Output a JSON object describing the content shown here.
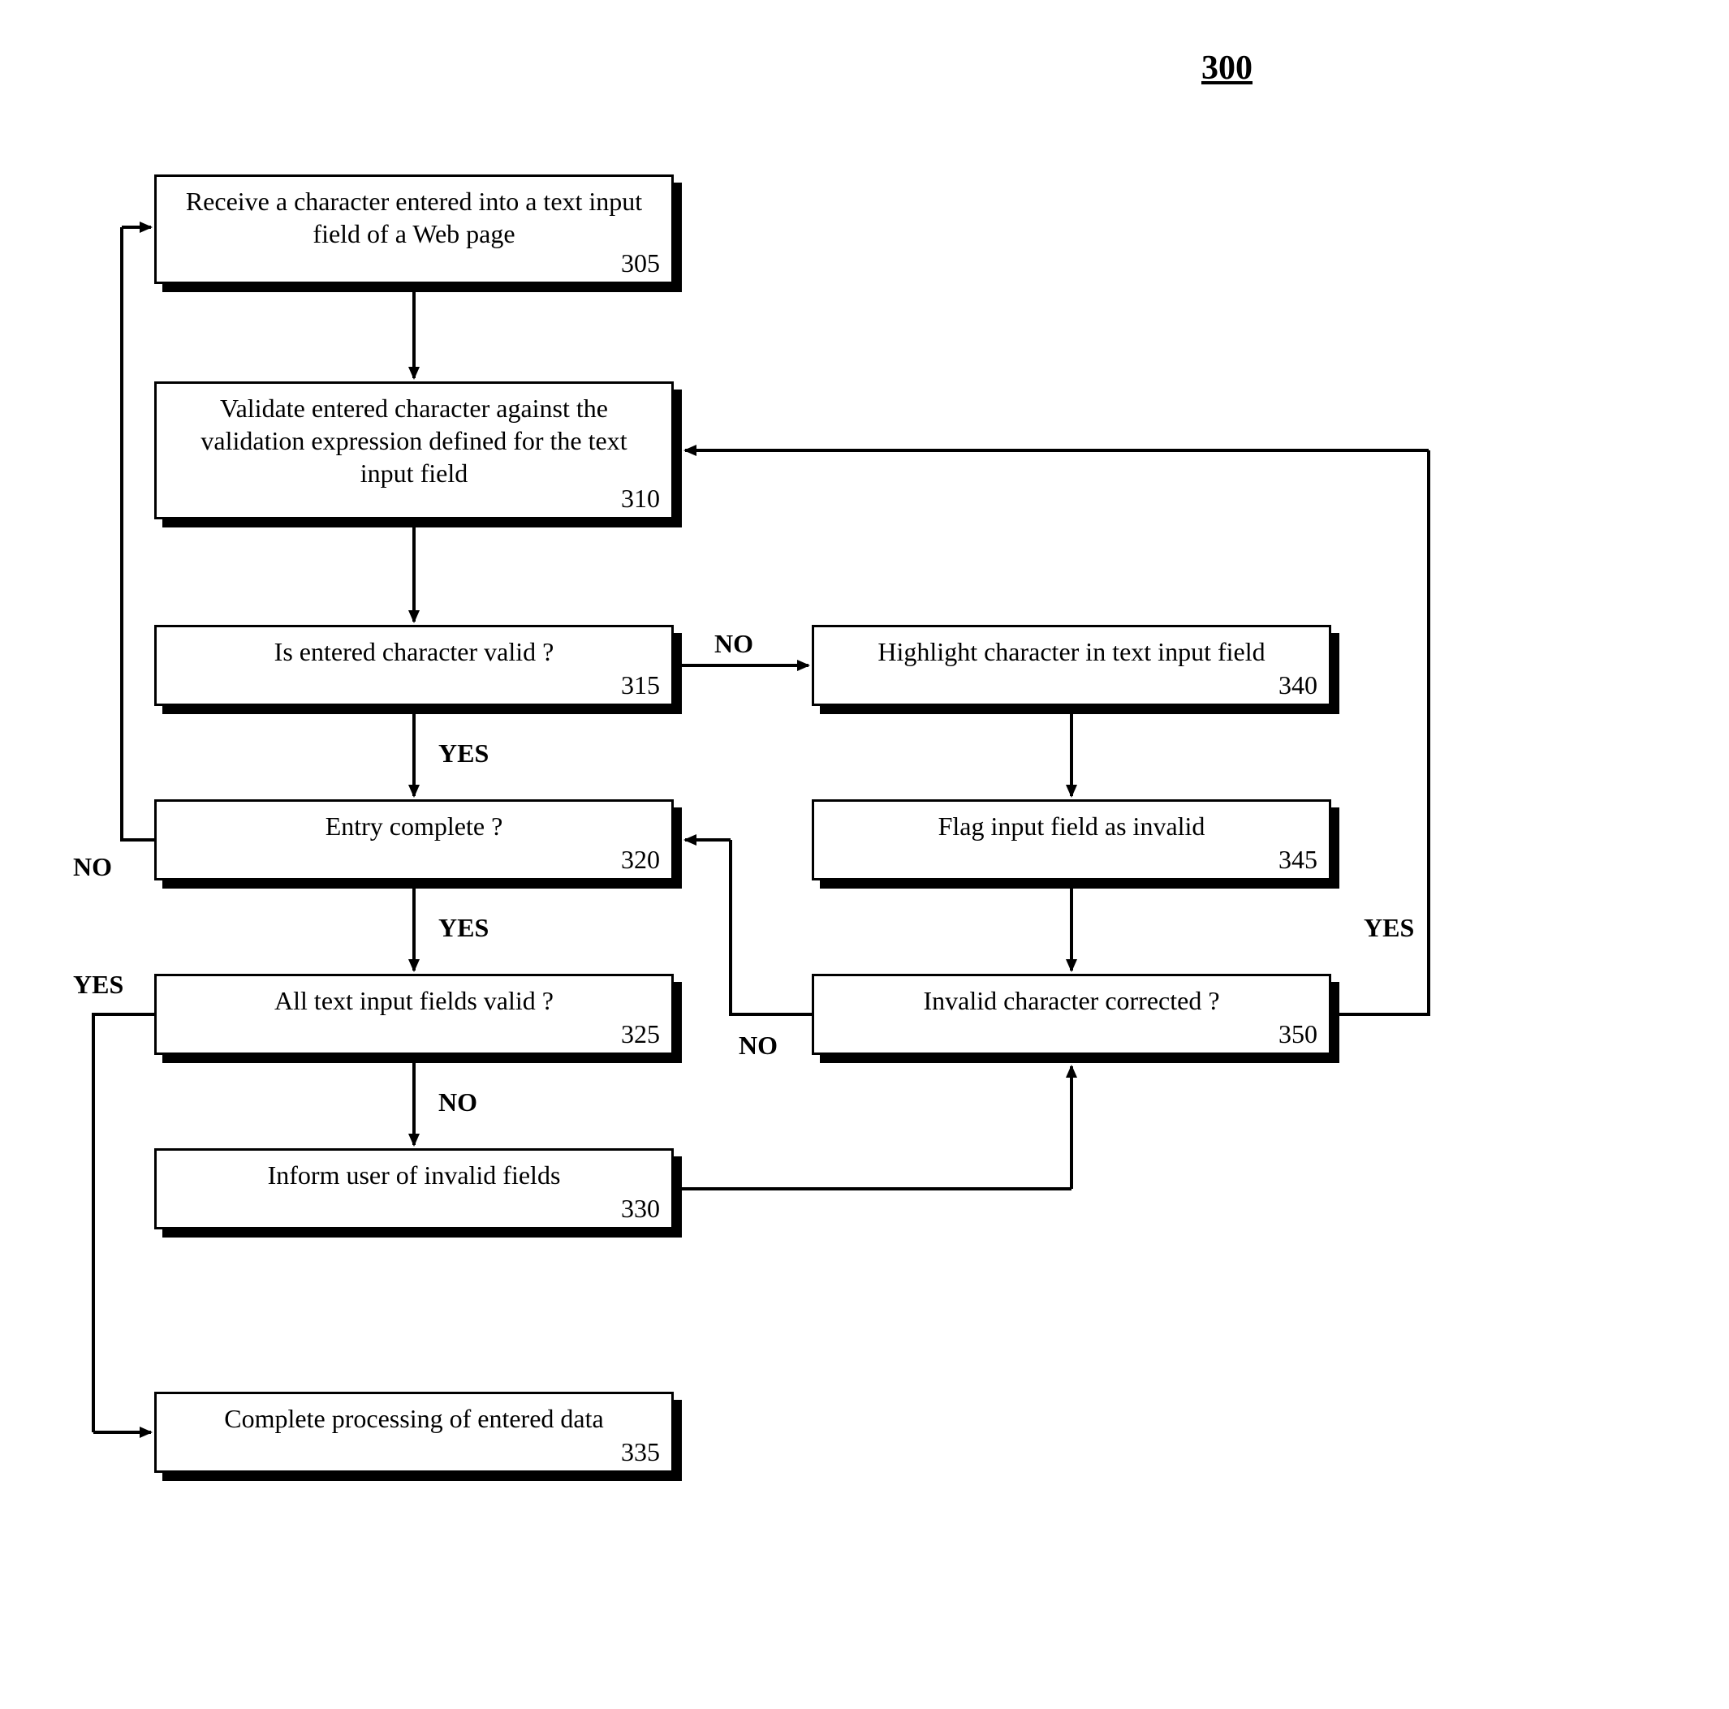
{
  "figure_number": "300",
  "nodes": {
    "n305": {
      "text": "Receive a character entered into a text input\nfield of a Web page",
      "num": "305"
    },
    "n310": {
      "text": "Validate entered character against the\nvalidation expression defined for the text\ninput field",
      "num": "310"
    },
    "n315": {
      "text": "Is entered character valid ?",
      "num": "315"
    },
    "n320": {
      "text": "Entry complete ?",
      "num": "320"
    },
    "n325": {
      "text": "All text input fields valid ?",
      "num": "325"
    },
    "n330": {
      "text": "Inform user of invalid fields",
      "num": "330"
    },
    "n335": {
      "text": "Complete processing of entered data",
      "num": "335"
    },
    "n340": {
      "text": "Highlight character in text input field",
      "num": "340"
    },
    "n345": {
      "text": "Flag input field as invalid",
      "num": "345"
    },
    "n350": {
      "text": "Invalid character corrected ?",
      "num": "350"
    }
  },
  "edge_labels": {
    "e315_yes": "YES",
    "e315_no": "NO",
    "e320_yes": "YES",
    "e320_no": "NO",
    "e325_yes": "YES",
    "e325_no": "NO",
    "e350_yes": "YES",
    "e350_no": "NO"
  }
}
